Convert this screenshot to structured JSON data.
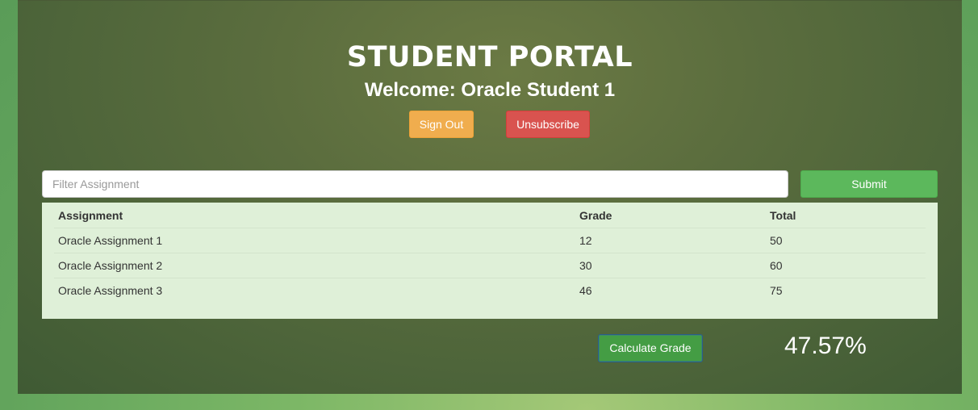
{
  "header": {
    "title": "STUDENT PORTAL",
    "welcome": "Welcome: Oracle Student 1"
  },
  "account": {
    "sign_out_label": "Sign Out",
    "unsubscribe_label": "Unsubscribe"
  },
  "filter": {
    "placeholder": "Filter Assignment",
    "value": "",
    "submit_label": "Submit"
  },
  "table": {
    "headers": [
      "Assignment",
      "Grade",
      "Total"
    ],
    "rows": [
      [
        "Oracle Assignment 1",
        "12",
        "50"
      ],
      [
        "Oracle Assignment 2",
        "30",
        "60"
      ],
      [
        "Oracle Assignment 3",
        "46",
        "75"
      ]
    ]
  },
  "grade": {
    "calculate_label": "Calculate Grade",
    "result": "47.57%"
  },
  "colors": {
    "warning": "#f0ad4e",
    "danger": "#d9534f",
    "success": "#5cb85c",
    "table_bg": "#dff0d8"
  }
}
